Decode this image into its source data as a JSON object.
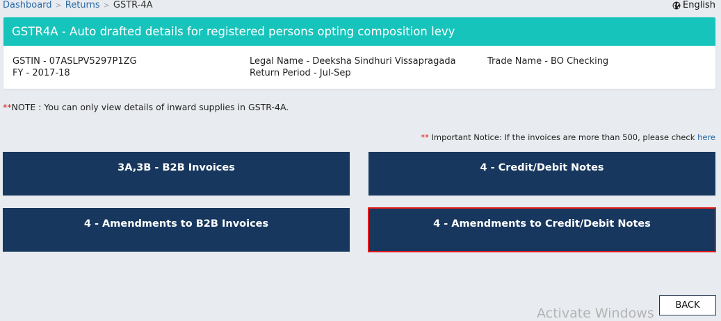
{
  "breadcrumb": {
    "items": [
      "Dashboard",
      "Returns",
      "GSTR-4A"
    ],
    "separator": ">"
  },
  "language": {
    "icon": "globe-icon",
    "label": "English"
  },
  "header_card": {
    "title": "GSTR4A - Auto drafted details for registered persons opting composition levy",
    "gstin": "GSTIN - 07ASLPV5297P1ZG",
    "fy": "FY - 2017-18",
    "legal_name": "Legal Name - Deeksha Sindhuri Vissapragada",
    "return_period": "Return Period - Jul-Sep",
    "trade_name": "Trade Name - BO Checking"
  },
  "note": {
    "stars": "**",
    "text": "NOTE : You can only view details of inward supplies in GSTR-4A."
  },
  "notice": {
    "stars": "**",
    "text": "Important Notice: If the invoices are more than 500, please check",
    "link_label": "here"
  },
  "tiles": [
    {
      "label": "3A,3B - B2B Invoices",
      "selected": false
    },
    {
      "label": "4 - Credit/Debit Notes",
      "selected": false
    },
    {
      "label": "4 - Amendments to B2B Invoices",
      "selected": false
    },
    {
      "label": "4 - Amendments to Credit/Debit Notes",
      "selected": true
    }
  ],
  "watermark": "Activate Windows",
  "back_button": "BACK",
  "colors": {
    "header_teal": "#17c4bb",
    "tile_navy": "#17375e",
    "selected_outline": "#e0191c",
    "link_blue": "#2a69a5",
    "note_red": "#e01b1b"
  }
}
